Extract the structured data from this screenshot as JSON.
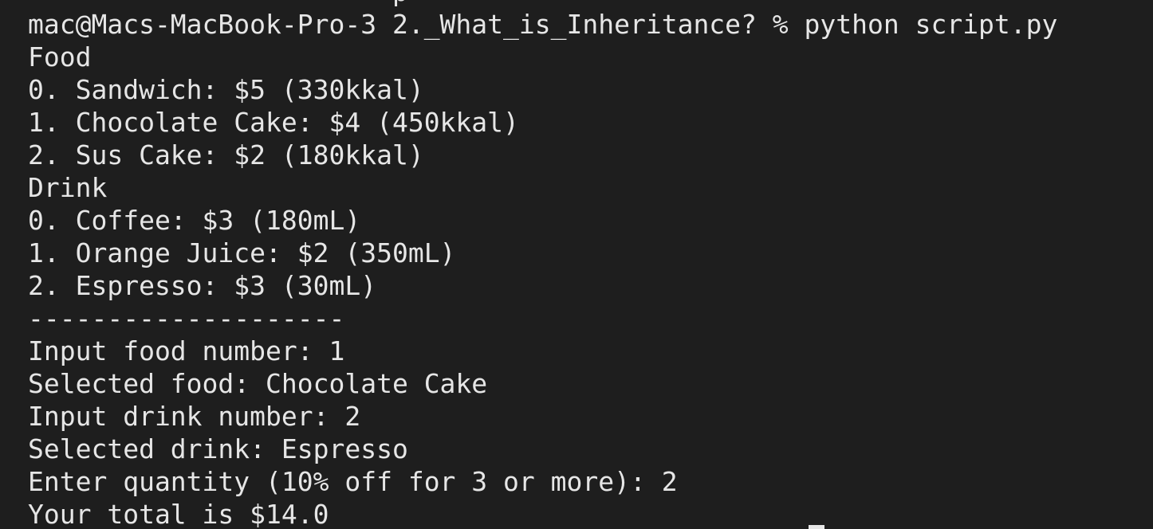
{
  "terminal": {
    "lines": [
      "mac@Macs-MacBook-Pro-3 2._What_is_Inheritance? % python script.py",
      "Food",
      "0. Sandwich: $5 (330kkal)",
      "1. Chocolate Cake: $4 (450kkal)",
      "2. Sus Cake: $2 (180kkal)",
      "Drink",
      "0. Coffee: $3 (180mL)",
      "1. Orange Juice: $2 (350mL)",
      "2. Espresso: $3 (30mL)",
      "--------------------",
      "Input food number: 1",
      "Selected food: Chocolate Cake",
      "Input drink number: 2",
      "Selected drink: Espresso",
      "Enter quantity (10% off for 3 or more): 2",
      "Your total is $14.0"
    ]
  },
  "colors": {
    "background": "#1e1e1e",
    "foreground": "#e6e6e6"
  }
}
